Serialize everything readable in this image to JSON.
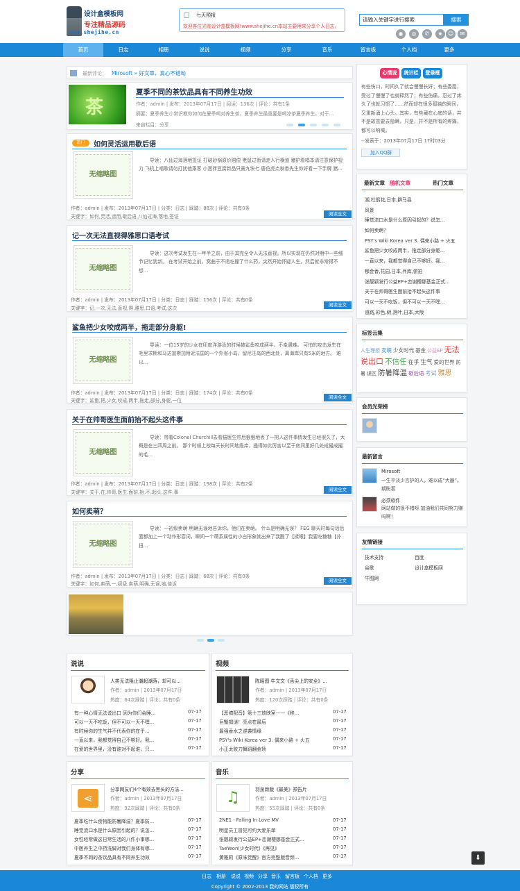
{
  "site": {
    "logo_line1": "设计盒模板网",
    "logo_line2": "专注精品源码",
    "logo_url": "www.shejihe.cn"
  },
  "notice": {
    "title": "七天预报",
    "message": "欢迎各位光临设计盒模板网!www.shejihe.cn本站主要用来分享个人日志。"
  },
  "search": {
    "value": "请输入关键字进行搜索",
    "button": "搜索"
  },
  "social_icons": [
    "rss-icon",
    "weibo-icon",
    "tencent-icon",
    "qzone-icon",
    "qq-icon",
    "mail-icon"
  ],
  "nav": {
    "items": [
      "首页",
      "日志",
      "相册",
      "说说",
      "视频",
      "分享",
      "音乐",
      "留言板",
      "个人档",
      "更多"
    ],
    "active": "首页"
  },
  "breadcrumb": {
    "label": "最新评论：",
    "text": "Mirosoft » 好文章，真心不错呦"
  },
  "featured": {
    "title": "夏季不同的茶饮品具有不同养生功效",
    "meta": "作者：admin | 发布：2013年07月17日 | 阅读：136次 | 评论：共有1条",
    "summary": "摘要：夏季养生小常识教你如何在夏季喝对养生茶，夏季养生最重要是喝凉茶夏季养生。对于...",
    "column": "来自栏目：分享",
    "image_text": "茶"
  },
  "posts": [
    {
      "title": "如何灵活运用歇后语",
      "hot": "热门",
      "thumb": "无缩略图",
      "excerpt": "导读：八仙过海落地签证 打破砂锅原价赔偿 老鼠过街请走人行横道 豬护着唱本请注意保护视力 飞机上唱歌请勿打扰他乘客 小葱拌豆腐新品只需九块七 唐伯虎点秋香先生你好看一下手牌 猪...",
      "meta": "作者：admin | 发布：2013年07月17日 | 分类：日志 | 踩踏：88次 | 评论：共有0条",
      "tags": "关键字：如何,灵活,运用,歇后语,八仙过海,落地,签证",
      "read": "阅读全文"
    },
    {
      "title": "记一次无法直视得雅思口语考试",
      "thumb": "无缩略图",
      "excerpt": "导读：这次考试发生在一年半之前，由于其完全令人无法直视。所以实现在仍然对期中一些细节记忆犹新。 在考试开始之前，窝曲于不适吃撞了什么药，突然开始怀疑人生，然后就非常得不想...",
      "meta": "作者：admin | 发布：2013年07月17日 | 分类：日志 | 踩踏：156次 | 评论：共有0条",
      "tags": "关键字：记,一次,无法,直视,得,雅思,口语,考试,这次",
      "read": "阅读全文"
    },
    {
      "title": "鲨鱼把少女咬成两半，拖走部分身躯!",
      "thumb": "无缩略图",
      "excerpt": "导读：一位15岁的少女在印度洋游泳的时候被鲨鱼咬成两半，不幸遇难。 可怕的攻击发生在毛里求斯和马达加斯加附近法国的一个外省小岛，留尼汪岛的西北处，离海岸只有5米的地方。 难以...",
      "meta": "作者：admin | 发布：2013年07月17日 | 分类：日志 | 踩踏：174次 | 评论：共有0条",
      "tags": "关键字：鲨鱼,把,少女,咬成,两半,拖走,部分,身躯,一位",
      "read": "阅读全文"
    },
    {
      "title": "关于在帅哥医生面前抬不起头这件事",
      "thumb": "无缩略图",
      "excerpt": "导读：带着Colonel Churchill去看猫医生然后狠狠地丢了一把人这件事情发生已经很久了，大概是在三四周之前。 那个时候上校每天长时间地瘙痒，搔得如此厉害以至于房间里好几处成撮成撮的毛...",
      "meta": "作者：admin | 发布：2013年07月17日 | 分类：日志 | 踩踏：198次 | 评论：共有2条",
      "tags": "关键字：关于,在,帅哥,医生,面前,抬,不,起头,这件,事",
      "read": "阅读全文"
    },
    {
      "title": "如何卖萌？",
      "thumb": "无缩略图",
      "excerpt": "导读：一初级卖萌 明确无误地告诉你，他们在卖萌。 什么是明确无误？ FEG 聊天时每句话后面都加上一个动作形容词，瞬间一个萌系属性的小白形象就出来了我醒了【揉眼】我要吃糖糖【扑扭...",
      "meta": "作者：admin | 发布：2013年07月17日 | 分类：日志 | 踩踏：68次 | 评论：共有0条",
      "tags": "关键字：如何,卖萌,一,初级,卖萌,明确,无误,地,告诉",
      "read": "阅读全文"
    }
  ],
  "sidebar": {
    "tabs": [
      "心情说",
      "统计栏",
      "登录框"
    ],
    "mood_text": "有些伤口，时间久了就会慢慢长好；有些委屈，受过了慢慢了也就释然了；有些伤痛，忍过了疼久了也就习惯了......然而却在很多孤独的瞬间，又重新涌上心头。其实，有些藏在心底的话，并不是故意要去隐瞒，只是，并不是所有的疼痛，都可以呐喊。",
    "mood_date": "--发表于：2013年07月17日 17时03分",
    "qq_group": "加入QQ群",
    "article_tabs": [
      "最新文章",
      "随机文章",
      "热门文章"
    ],
    "articles": [
      "湖,杜鹃花,日本,群马县",
      "风景",
      "睡觉流口水是什么原因引起的？说怎...",
      "如何卖萌？",
      "PSY's Wiki Korea ver 3. 偶来小路 + 火五",
      "鲨鱼把少女咬成两半，拖走部分身躯...",
      "一直以来，我都觉得自己不够好。我...",
      "郁金香,花园,日本,兵库,俯拍",
      "张靓颖发行公益EP+恋谢樱娜基金正式...",
      "关于在帅哥医生面前抬不起头这件事",
      "可以一天不吃饭，但不可以一天不嘿...",
      "道路,彩色,树,落叶,日本,大阪"
    ],
    "tagcloud_title": "标签云集",
    "tags": [
      {
        "t": "人生理想",
        "c": "#6a9fd4",
        "s": 7
      },
      {
        "t": "卖萌",
        "c": "#3b8fcf",
        "s": 7.5
      },
      {
        "t": "少女时代",
        "c": "#555555",
        "s": 7.5
      },
      {
        "t": "基金",
        "c": "#555555",
        "s": 7.5
      },
      {
        "t": "公益EP",
        "c": "#d97fbe",
        "s": 7
      },
      {
        "t": "无法说出口",
        "c": "#e04141",
        "s": 11
      },
      {
        "t": "不信任",
        "c": "#49a04a",
        "s": 10.5
      },
      {
        "t": "在乎",
        "c": "#555555",
        "s": 8
      },
      {
        "t": "生气",
        "c": "#555555",
        "s": 8.5
      },
      {
        "t": "爱的世界",
        "c": "#555555",
        "s": 7.5
      },
      {
        "t": "防暑",
        "c": "#555555",
        "s": 7
      },
      {
        "t": "误区",
        "c": "#555555",
        "s": 7
      },
      {
        "t": "防暑降温",
        "c": "#444444",
        "s": 10.5
      },
      {
        "t": "歇后语",
        "c": "#9b4eb0",
        "s": 7.5
      },
      {
        "t": "考试",
        "c": "#7fa0cf",
        "s": 8
      },
      {
        "t": "雅思",
        "c": "#d08a3a",
        "s": 10
      }
    ],
    "members_title": "会员光荣榜",
    "guestbook_title": "最新留言",
    "guestbook": [
      {
        "name": "Mirosoft",
        "text": "一生平淡少言护的人，难以成“大器”。期盼着"
      },
      {
        "name": "必须软件",
        "text": "网站做的很不错呀 加油我们共同努力赚吗啊！"
      }
    ],
    "links_title": "友情链接",
    "links": [
      "技术支持",
      "百度",
      "谷歌",
      "设计盒模板网",
      "牛图网"
    ]
  },
  "sections": [
    {
      "title": "说说",
      "top_title": "人类无法阻止潮起潮落，却可以...",
      "top_meta1": "作者：admin | 2013年07月17日",
      "top_meta2": "热度：64次踩踏 | 评论：共有0条",
      "items": [
        [
          "有一种心情无法说出口 因为你们会睡...",
          "07-17"
        ],
        [
          "可以一天不吃饭，但不可以一天不嘿...",
          "07-17"
        ],
        [
          "有时候你的生气并不代表你的在乎...",
          "07-17"
        ],
        [
          "一直以来，我都觉得自己不够好。我...",
          "07-17"
        ],
        [
          "在爱的世界里，没有谁对不起谁，只...",
          "07-17"
        ]
      ]
    },
    {
      "title": "视频",
      "top_title": "陈昭图 牛文文《舌尖上的安全》...",
      "top_meta1": "作者：admin | 2013年07月17日",
      "top_meta2": "热度：120次踩踏 | 评论：共有0条",
      "items": [
        [
          "【恶搞配音】第十三放映室——《移...",
          "07-17"
        ],
        [
          "巨蟹揭谜！亮点在最后",
          "07-17"
        ],
        [
          "最强香水之逆袭情缘",
          "07-17"
        ],
        [
          "PSY's Wiki Korea ver 3. 偶来小路 + 火五",
          "07-17"
        ],
        [
          "小正太飲刀舞蹈翻金场",
          "07-17"
        ]
      ]
    },
    {
      "title": "分享",
      "top_title": "分享网友们4个有效去黑头的方法...",
      "top_meta1": "作者：admin | 2013年07月17日",
      "top_meta2": "热度：92次踩踏 | 评论：共有0条",
      "items": [
        [
          "夏季吃什么食物能防暑降温？夏季防...",
          "07-17"
        ],
        [
          "睡觉流口水是什么原因引起的？说怎...",
          "07-17"
        ],
        [
          "女性经常做这日常生活的八件小事哪...",
          "07-17"
        ],
        [
          "中医养生之中药洗脚对我们身体有哪...",
          "07-17"
        ],
        [
          "夏季不同的茶饮品具有不同养生功效",
          "07-17"
        ]
      ]
    },
    {
      "title": "音乐",
      "top_title": "羽泉新版《最美》预告片",
      "top_meta1": "作者：admin | 2013年07月17日",
      "top_meta2": "热度：55次踩踏 | 评论：共有0条",
      "items": [
        [
          "2NE1 - Falling In Love MV",
          "07-17"
        ],
        [
          "明星员工冒犯可约大爱乐单",
          "07-17"
        ],
        [
          "张靓颖发行公益EP+恋谢樱娜基金正式...",
          "07-17"
        ],
        [
          "TaeYeon(少女时代)《再见》",
          "07-17"
        ],
        [
          "黄雅莉《原味觉醒》官方完整版音频...",
          "07-17"
        ]
      ]
    }
  ],
  "footer": {
    "nav": [
      "日志",
      "相册",
      "说说",
      "视频",
      "分享",
      "音乐",
      "留言板",
      "个人档",
      "更多"
    ],
    "copyright": "Copyright © 2002-2013 我的网站 版权所有"
  },
  "colors": {
    "primary": "#1b87d7",
    "nav_active": "#5eb2ee",
    "red_tab": "#e8386c",
    "title": "#253a52"
  }
}
